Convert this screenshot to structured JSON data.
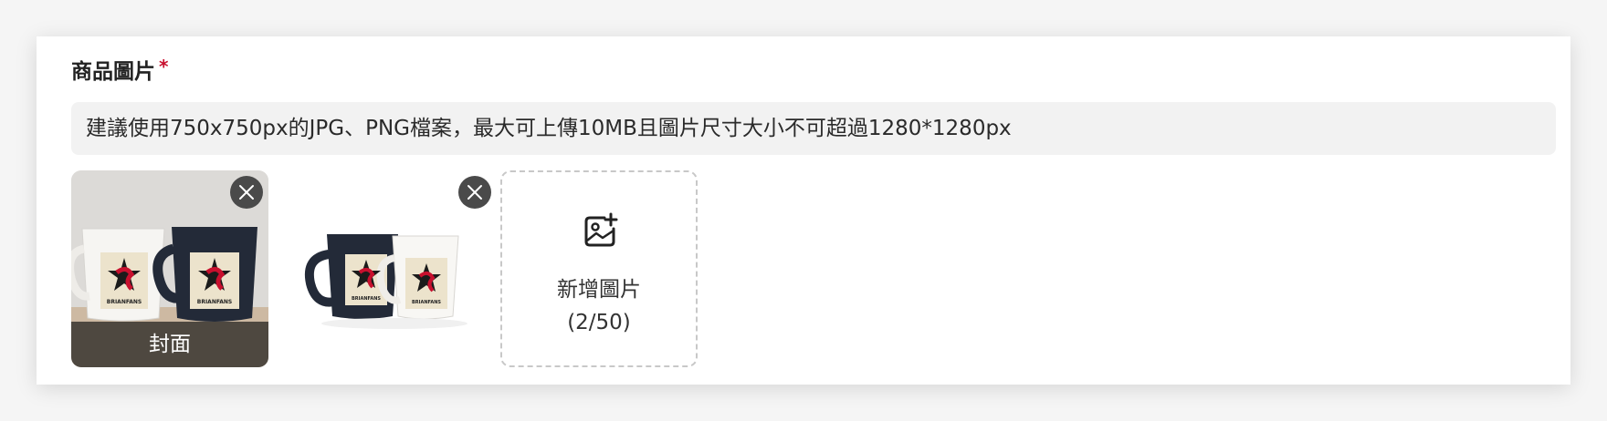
{
  "section": {
    "title": "商品圖片",
    "required_mark": "*"
  },
  "hint": {
    "text": "建議使用750x750px的JPG、PNG檔案，最大可上傳10MB且圖片尺寸大小不可超過1280*1280px"
  },
  "images": [
    {
      "alt": "mug photo 1",
      "cover_label": "封面",
      "is_cover": true,
      "remove_icon": "close-icon",
      "mug_label": "BRIANFANS"
    },
    {
      "alt": "mug photo 2",
      "is_cover": false,
      "remove_icon": "close-icon",
      "mug_label": "BRIANFANS"
    }
  ],
  "add_tile": {
    "icon": "add-image-icon",
    "label": "新增圖片",
    "count": "(2/50)"
  },
  "colors": {
    "required": "#c8102e",
    "hint_bg": "#f2f2f2",
    "cover_overlay": "#3c3832",
    "remove_button": "#4a4a4a"
  }
}
